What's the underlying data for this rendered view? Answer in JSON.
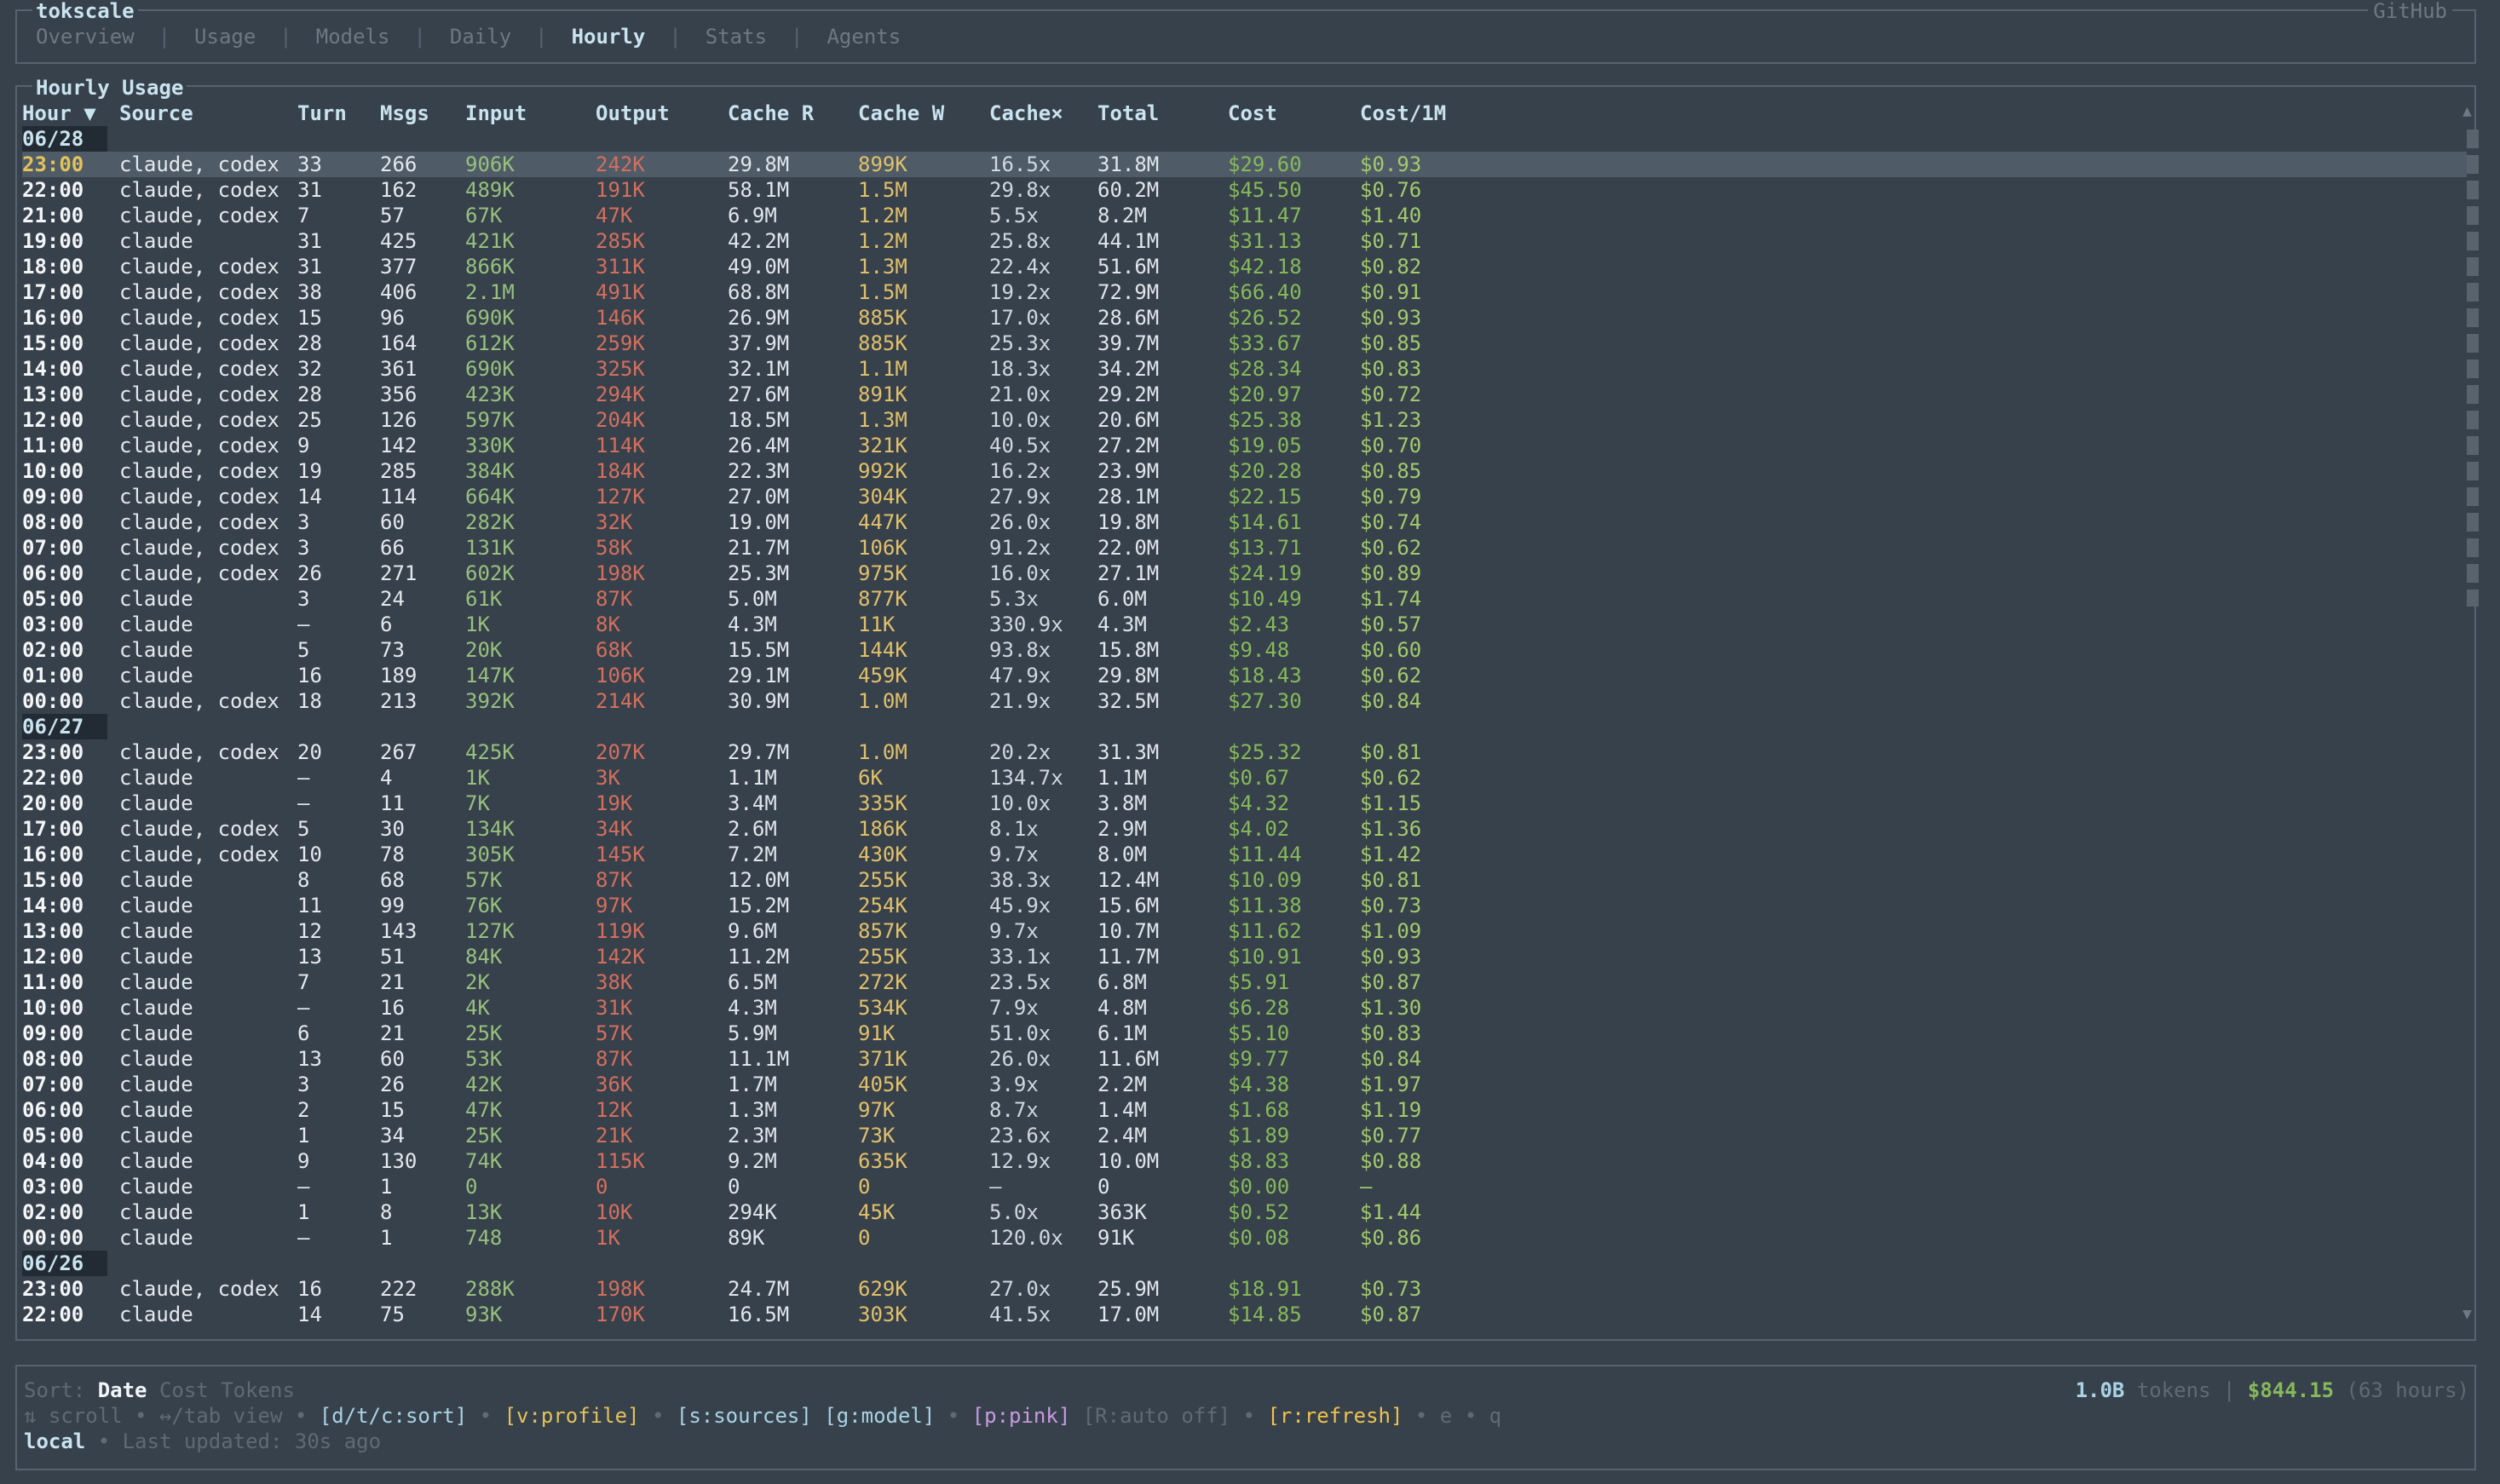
{
  "app": {
    "title": "tokscale",
    "github": "GitHub"
  },
  "tabs": [
    "Overview",
    "Usage",
    "Models",
    "Daily",
    "Hourly",
    "Stats",
    "Agents"
  ],
  "active_tab": "Hourly",
  "panel": {
    "title": "Hourly Usage"
  },
  "table": {
    "headers": {
      "hour": "Hour ▼",
      "source": "Source",
      "turn": "Turn",
      "msgs": "Msgs",
      "input": "Input",
      "output": "Output",
      "cache_r": "Cache R",
      "cache_w": "Cache W",
      "cache_x": "Cache×",
      "total": "Total",
      "cost": "Cost",
      "cost_per_m": "Cost/1M"
    },
    "groups": [
      {
        "date": "06/28",
        "rows": [
          [
            "23:00",
            "claude, codex",
            "33",
            "266",
            "906K",
            "242K",
            "29.8M",
            "899K",
            "16.5x",
            "31.8M",
            "$29.60",
            "$0.93"
          ],
          [
            "22:00",
            "claude, codex",
            "31",
            "162",
            "489K",
            "191K",
            "58.1M",
            "1.5M",
            "29.8x",
            "60.2M",
            "$45.50",
            "$0.76"
          ],
          [
            "21:00",
            "claude, codex",
            "7",
            "57",
            "67K",
            "47K",
            "6.9M",
            "1.2M",
            "5.5x",
            "8.2M",
            "$11.47",
            "$1.40"
          ],
          [
            "19:00",
            "claude",
            "31",
            "425",
            "421K",
            "285K",
            "42.2M",
            "1.2M",
            "25.8x",
            "44.1M",
            "$31.13",
            "$0.71"
          ],
          [
            "18:00",
            "claude, codex",
            "31",
            "377",
            "866K",
            "311K",
            "49.0M",
            "1.3M",
            "22.4x",
            "51.6M",
            "$42.18",
            "$0.82"
          ],
          [
            "17:00",
            "claude, codex",
            "38",
            "406",
            "2.1M",
            "491K",
            "68.8M",
            "1.5M",
            "19.2x",
            "72.9M",
            "$66.40",
            "$0.91"
          ],
          [
            "16:00",
            "claude, codex",
            "15",
            "96",
            "690K",
            "146K",
            "26.9M",
            "885K",
            "17.0x",
            "28.6M",
            "$26.52",
            "$0.93"
          ],
          [
            "15:00",
            "claude, codex",
            "28",
            "164",
            "612K",
            "259K",
            "37.9M",
            "885K",
            "25.3x",
            "39.7M",
            "$33.67",
            "$0.85"
          ],
          [
            "14:00",
            "claude, codex",
            "32",
            "361",
            "690K",
            "325K",
            "32.1M",
            "1.1M",
            "18.3x",
            "34.2M",
            "$28.34",
            "$0.83"
          ],
          [
            "13:00",
            "claude, codex",
            "28",
            "356",
            "423K",
            "294K",
            "27.6M",
            "891K",
            "21.0x",
            "29.2M",
            "$20.97",
            "$0.72"
          ],
          [
            "12:00",
            "claude, codex",
            "25",
            "126",
            "597K",
            "204K",
            "18.5M",
            "1.3M",
            "10.0x",
            "20.6M",
            "$25.38",
            "$1.23"
          ],
          [
            "11:00",
            "claude, codex",
            "9",
            "142",
            "330K",
            "114K",
            "26.4M",
            "321K",
            "40.5x",
            "27.2M",
            "$19.05",
            "$0.70"
          ],
          [
            "10:00",
            "claude, codex",
            "19",
            "285",
            "384K",
            "184K",
            "22.3M",
            "992K",
            "16.2x",
            "23.9M",
            "$20.28",
            "$0.85"
          ],
          [
            "09:00",
            "claude, codex",
            "14",
            "114",
            "664K",
            "127K",
            "27.0M",
            "304K",
            "27.9x",
            "28.1M",
            "$22.15",
            "$0.79"
          ],
          [
            "08:00",
            "claude, codex",
            "3",
            "60",
            "282K",
            "32K",
            "19.0M",
            "447K",
            "26.0x",
            "19.8M",
            "$14.61",
            "$0.74"
          ],
          [
            "07:00",
            "claude, codex",
            "3",
            "66",
            "131K",
            "58K",
            "21.7M",
            "106K",
            "91.2x",
            "22.0M",
            "$13.71",
            "$0.62"
          ],
          [
            "06:00",
            "claude, codex",
            "26",
            "271",
            "602K",
            "198K",
            "25.3M",
            "975K",
            "16.0x",
            "27.1M",
            "$24.19",
            "$0.89"
          ],
          [
            "05:00",
            "claude",
            "3",
            "24",
            "61K",
            "87K",
            "5.0M",
            "877K",
            "5.3x",
            "6.0M",
            "$10.49",
            "$1.74"
          ],
          [
            "03:00",
            "claude",
            "—",
            "6",
            "1K",
            "8K",
            "4.3M",
            "11K",
            "330.9x",
            "4.3M",
            "$2.43",
            "$0.57"
          ],
          [
            "02:00",
            "claude",
            "5",
            "73",
            "20K",
            "68K",
            "15.5M",
            "144K",
            "93.8x",
            "15.8M",
            "$9.48",
            "$0.60"
          ],
          [
            "01:00",
            "claude",
            "16",
            "189",
            "147K",
            "106K",
            "29.1M",
            "459K",
            "47.9x",
            "29.8M",
            "$18.43",
            "$0.62"
          ],
          [
            "00:00",
            "claude, codex",
            "18",
            "213",
            "392K",
            "214K",
            "30.9M",
            "1.0M",
            "21.9x",
            "32.5M",
            "$27.30",
            "$0.84"
          ]
        ]
      },
      {
        "date": "06/27",
        "rows": [
          [
            "23:00",
            "claude, codex",
            "20",
            "267",
            "425K",
            "207K",
            "29.7M",
            "1.0M",
            "20.2x",
            "31.3M",
            "$25.32",
            "$0.81"
          ],
          [
            "22:00",
            "claude",
            "—",
            "4",
            "1K",
            "3K",
            "1.1M",
            "6K",
            "134.7x",
            "1.1M",
            "$0.67",
            "$0.62"
          ],
          [
            "20:00",
            "claude",
            "—",
            "11",
            "7K",
            "19K",
            "3.4M",
            "335K",
            "10.0x",
            "3.8M",
            "$4.32",
            "$1.15"
          ],
          [
            "17:00",
            "claude, codex",
            "5",
            "30",
            "134K",
            "34K",
            "2.6M",
            "186K",
            "8.1x",
            "2.9M",
            "$4.02",
            "$1.36"
          ],
          [
            "16:00",
            "claude, codex",
            "10",
            "78",
            "305K",
            "145K",
            "7.2M",
            "430K",
            "9.7x",
            "8.0M",
            "$11.44",
            "$1.42"
          ],
          [
            "15:00",
            "claude",
            "8",
            "68",
            "57K",
            "87K",
            "12.0M",
            "255K",
            "38.3x",
            "12.4M",
            "$10.09",
            "$0.81"
          ],
          [
            "14:00",
            "claude",
            "11",
            "99",
            "76K",
            "97K",
            "15.2M",
            "254K",
            "45.9x",
            "15.6M",
            "$11.38",
            "$0.73"
          ],
          [
            "13:00",
            "claude",
            "12",
            "143",
            "127K",
            "119K",
            "9.6M",
            "857K",
            "9.7x",
            "10.7M",
            "$11.62",
            "$1.09"
          ],
          [
            "12:00",
            "claude",
            "13",
            "51",
            "84K",
            "142K",
            "11.2M",
            "255K",
            "33.1x",
            "11.7M",
            "$10.91",
            "$0.93"
          ],
          [
            "11:00",
            "claude",
            "7",
            "21",
            "2K",
            "38K",
            "6.5M",
            "272K",
            "23.5x",
            "6.8M",
            "$5.91",
            "$0.87"
          ],
          [
            "10:00",
            "claude",
            "—",
            "16",
            "4K",
            "31K",
            "4.3M",
            "534K",
            "7.9x",
            "4.8M",
            "$6.28",
            "$1.30"
          ],
          [
            "09:00",
            "claude",
            "6",
            "21",
            "25K",
            "57K",
            "5.9M",
            "91K",
            "51.0x",
            "6.1M",
            "$5.10",
            "$0.83"
          ],
          [
            "08:00",
            "claude",
            "13",
            "60",
            "53K",
            "87K",
            "11.1M",
            "371K",
            "26.0x",
            "11.6M",
            "$9.77",
            "$0.84"
          ],
          [
            "07:00",
            "claude",
            "3",
            "26",
            "42K",
            "36K",
            "1.7M",
            "405K",
            "3.9x",
            "2.2M",
            "$4.38",
            "$1.97"
          ],
          [
            "06:00",
            "claude",
            "2",
            "15",
            "47K",
            "12K",
            "1.3M",
            "97K",
            "8.7x",
            "1.4M",
            "$1.68",
            "$1.19"
          ],
          [
            "05:00",
            "claude",
            "1",
            "34",
            "25K",
            "21K",
            "2.3M",
            "73K",
            "23.6x",
            "2.4M",
            "$1.89",
            "$0.77"
          ],
          [
            "04:00",
            "claude",
            "9",
            "130",
            "74K",
            "115K",
            "9.2M",
            "635K",
            "12.9x",
            "10.0M",
            "$8.83",
            "$0.88"
          ],
          [
            "03:00",
            "claude",
            "—",
            "1",
            "0",
            "0",
            "0",
            "0",
            "—",
            "0",
            "$0.00",
            "—"
          ],
          [
            "02:00",
            "claude",
            "1",
            "8",
            "13K",
            "10K",
            "294K",
            "45K",
            "5.0x",
            "363K",
            "$0.52",
            "$1.44"
          ],
          [
            "00:00",
            "claude",
            "—",
            "1",
            "748",
            "1K",
            "89K",
            "0",
            "120.0x",
            "91K",
            "$0.08",
            "$0.86"
          ]
        ]
      },
      {
        "date": "06/26",
        "rows": [
          [
            "23:00",
            "claude, codex",
            "16",
            "222",
            "288K",
            "198K",
            "24.7M",
            "629K",
            "27.0x",
            "25.9M",
            "$18.91",
            "$0.73"
          ],
          [
            "22:00",
            "claude",
            "14",
            "75",
            "93K",
            "170K",
            "16.5M",
            "303K",
            "41.5x",
            "17.0M",
            "$14.85",
            "$0.87"
          ]
        ]
      }
    ]
  },
  "footer": {
    "sort_label": "Sort:",
    "sort_options": [
      "Date",
      "Cost",
      "Tokens"
    ],
    "sort_active": "Date",
    "keys": {
      "scroll": "⇅ scroll",
      "tab_view": "↔/tab view",
      "sort": "[d/t/c:sort]",
      "profile": "[v:profile]",
      "sources": "[s:sources]",
      "model": "[g:model]",
      "pink": "[p:pink]",
      "auto": "[R:auto off]",
      "refresh": "[r:refresh]",
      "e": "e",
      "q": "q"
    },
    "source": "local",
    "last_updated": "Last updated: 30s ago",
    "summary": {
      "tokens_value": "1.0B",
      "tokens_label": "tokens",
      "cost": "$844.15",
      "hours": "(63 hours)"
    }
  },
  "colors": {
    "background": "#37414c",
    "input": "#97c07d",
    "output": "#d36f5d",
    "cache_w": "#e1c06a",
    "cost": "#86b95a",
    "accent": "#c9e3ef",
    "selected_row": "#4f5c68"
  }
}
